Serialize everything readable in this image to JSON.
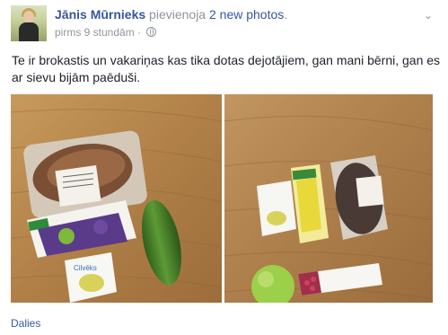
{
  "post": {
    "author": "Jānis Mūrnieks",
    "action_prefix": " pievienoja ",
    "action_link": "2 new photos",
    "action_suffix": ".",
    "time": "pirms 9 stundām",
    "separator": " · ",
    "audience_icon": "globe-icon",
    "menu_icon": "chevron-down-icon",
    "text": "Te ir brokastis un vakariņas kas tika dotas dejotājiem, gan mani bērni, gan es ar sievu bijām paēduši.",
    "photos": [
      {
        "alt": "photo-1"
      },
      {
        "alt": "photo-2"
      }
    ],
    "share_label": "Dalies"
  },
  "colors": {
    "link": "#365899",
    "meta": "#90949c",
    "wood": "#b88a4e"
  }
}
